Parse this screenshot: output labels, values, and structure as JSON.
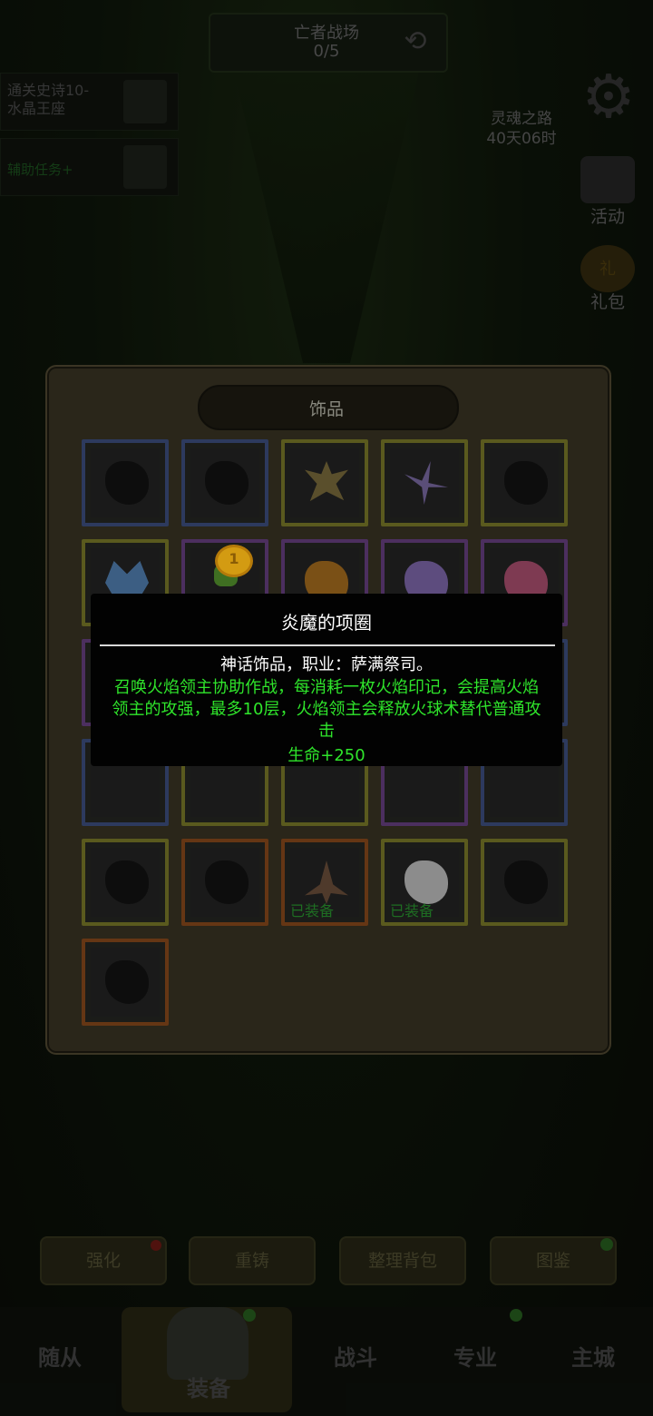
{
  "header": {
    "battlefield_title": "亡者战场",
    "battlefield_count": "0/5"
  },
  "quests": {
    "quest1_line1": "通关史诗10-",
    "quest1_line2": "水晶王座",
    "quest2": "辅助任务+"
  },
  "side": {
    "soul_line1": "灵魂之路",
    "soul_line2": "40天06时",
    "activity_label": "活动",
    "gift_label": "礼包",
    "gift_icon_text": "礼"
  },
  "panel": {
    "title": "饰品",
    "equipped_label": "已装备",
    "coin_text": "1"
  },
  "tooltip": {
    "title": "炎魔的项圈",
    "subtitle": "神话饰品，职业：萨满祭司。",
    "description": "召唤火焰领主协助作战，每消耗一枚火焰印记，会提高火焰领主的攻强，最多10层，火焰领主会释放火球术替代普通攻击",
    "stat": "生命+250"
  },
  "bottom_buttons": [
    "强化",
    "重铸",
    "整理背包",
    "图鉴"
  ],
  "nav": [
    "随从",
    "装备",
    "战斗",
    "专业",
    "主城"
  ],
  "colors": {
    "tooltip_green": "#2fe52b",
    "equipped_green": "#1e6e22",
    "panel_bg": "#2a261a"
  }
}
